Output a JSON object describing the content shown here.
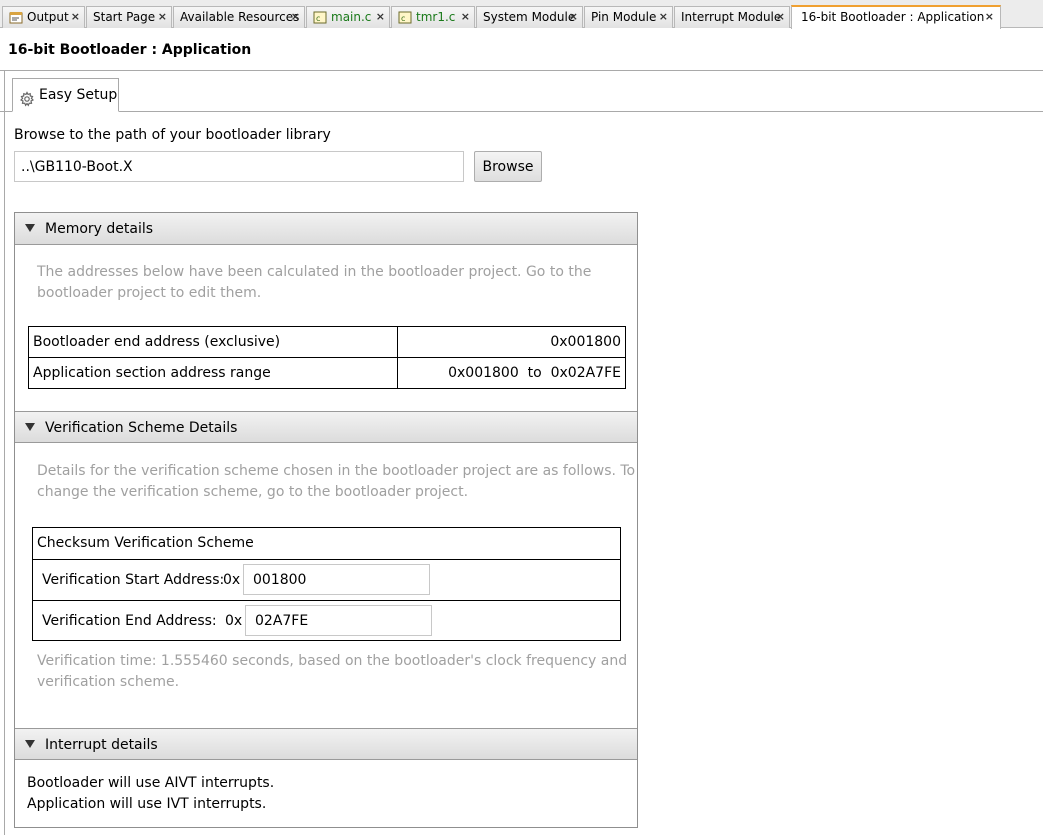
{
  "tabs": [
    {
      "label": "Output",
      "icon": "output-icon"
    },
    {
      "label": "Start Page"
    },
    {
      "label": "Available Resources"
    },
    {
      "label": "main.c",
      "icon": "c-file-icon"
    },
    {
      "label": "tmr1.c",
      "icon": "c-file-icon"
    },
    {
      "label": "System Module"
    },
    {
      "label": "Pin Module"
    },
    {
      "label": "Interrupt Module"
    },
    {
      "label": "16-bit Bootloader : Application",
      "active": true
    }
  ],
  "tab_close_glyph": "×",
  "page_title": "16-bit Bootloader : Application",
  "subtab": {
    "label": "Easy Setup",
    "icon": "gear-icon"
  },
  "browse": {
    "label": "Browse to the path of your bootloader library",
    "path_value": "..\\GB110-Boot.X",
    "button_label": "Browse"
  },
  "memory": {
    "header": "Memory details",
    "description_line1": "The addresses below have been calculated in the bootloader project. Go to the",
    "description_line2": "bootloader project to edit them.",
    "rows": [
      {
        "label": "Bootloader end address (exclusive)",
        "value": "0x001800"
      },
      {
        "label": "Application section address range",
        "value": "0x001800  to  0x02A7FE"
      }
    ]
  },
  "verification": {
    "header": "Verification Scheme Details",
    "description_line1": "Details for the verification scheme chosen in the bootloader project are as follows. To",
    "description_line2": "change the verification scheme, go to the bootloader project.",
    "scheme_title": "Checksum Verification Scheme",
    "start_label": "Verification Start Address:",
    "start_prefix": "0x",
    "start_value": "001800",
    "end_label": "Verification End Address:",
    "end_prefix": "0x",
    "end_value": "02A7FE",
    "time_line1": "Verification time: 1.555460 seconds, based on the bootloader's clock frequency and",
    "time_line2": "verification scheme."
  },
  "interrupts": {
    "header": "Interrupt details",
    "line1": "Bootloader will use AIVT interrupts.",
    "line2": "Application will use IVT interrupts."
  },
  "colors": {
    "active_tab_accent": "#f0a030",
    "c_file_label": "#1a7a1a",
    "muted_text": "#a0a0a0"
  }
}
